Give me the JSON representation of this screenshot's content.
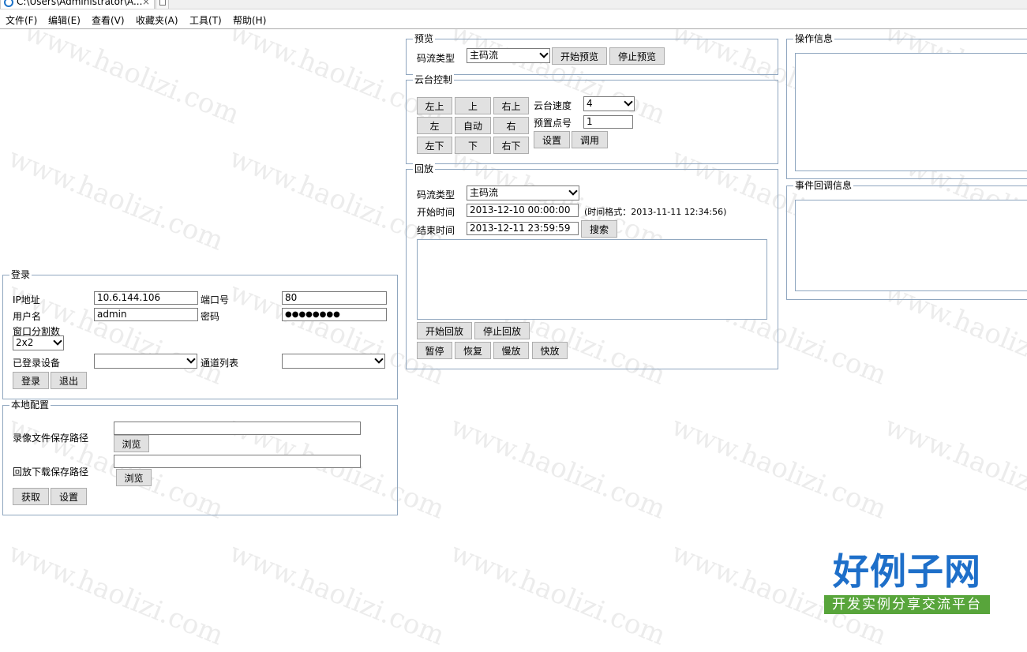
{
  "browser": {
    "tab_title": "C:\\Users\\Administrator\\A...",
    "tab_close": "×"
  },
  "menu": [
    "文件(F)",
    "编辑(E)",
    "查看(V)",
    "收藏夹(A)",
    "工具(T)",
    "帮助(H)"
  ],
  "login": {
    "legend": "登录",
    "ip_label": "IP地址",
    "ip_value": "10.6.144.106",
    "port_label": "端口号",
    "port_value": "80",
    "user_label": "用户名",
    "user_value": "admin",
    "pwd_label": "密码",
    "pwd_value": "●●●●●●●●",
    "split_label": "窗口分割数",
    "split_value": "2x2",
    "devices_label": "已登录设备",
    "devices_value": "",
    "channels_label": "通道列表",
    "channels_value": "",
    "login_btn": "登录",
    "logout_btn": "退出"
  },
  "local": {
    "legend": "本地配置",
    "record_label": "录像文件保存路径",
    "record_value": "",
    "download_label": "回放下载保存路径",
    "download_value": "",
    "browse_btn": "浏览",
    "get_btn": "获取",
    "set_btn": "设置"
  },
  "preview": {
    "legend": "预览",
    "stream_label": "码流类型",
    "stream_value": "主码流",
    "start_btn": "开始预览",
    "stop_btn": "停止预览"
  },
  "ptz": {
    "legend": "云台控制",
    "dirs": [
      "左上",
      "上",
      "右上",
      "左",
      "自动",
      "右",
      "左下",
      "下",
      "右下"
    ],
    "speed_label": "云台速度",
    "speed_value": "4",
    "preset_label": "预置点号",
    "preset_value": "1",
    "set_btn": "设置",
    "call_btn": "调用"
  },
  "playback": {
    "legend": "回放",
    "stream_label": "码流类型",
    "stream_value": "主码流",
    "start_label": "开始时间",
    "start_value": "2013-12-10 00:00:00",
    "format_hint": "(时间格式：2013-11-11 12:34:56)",
    "end_label": "结束时间",
    "end_value": "2013-12-11 23:59:59",
    "search_btn": "搜索",
    "start_play_btn": "开始回放",
    "stop_play_btn": "停止回放",
    "pause_btn": "暂停",
    "resume_btn": "恢复",
    "slow_btn": "慢放",
    "fast_btn": "快放"
  },
  "ops": {
    "legend": "操作信息"
  },
  "events": {
    "legend": "事件回调信息"
  },
  "watermark": "www.haolizi.com",
  "logo": {
    "main": "好例子网",
    "sub": "开发实例分享交流平台"
  }
}
